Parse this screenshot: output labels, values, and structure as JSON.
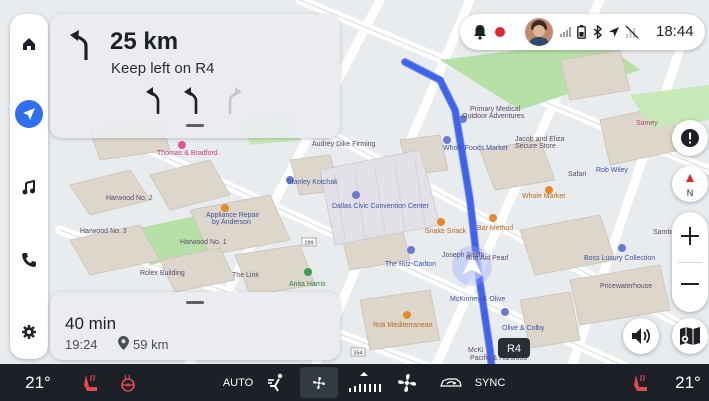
{
  "navigation": {
    "distance": "25 km",
    "instruction": "Keep left on R4",
    "lanes": [
      "keep-left-arrow",
      "keep-left-arrow",
      "keep-left-arrow-inactive"
    ]
  },
  "eta": {
    "duration": "40 min",
    "arrival_time": "19:24",
    "remaining_distance": "59 km"
  },
  "status_bar": {
    "time": "18:44",
    "icons": [
      "bell-icon",
      "recording-dot-icon",
      "avatar",
      "signal-icon",
      "battery-icon",
      "bluetooth-icon",
      "location-icon",
      "no-signal-icon"
    ]
  },
  "sidebar": {
    "items": [
      {
        "name": "home-icon"
      },
      {
        "name": "navigation-icon",
        "active": true
      },
      {
        "name": "music-icon"
      },
      {
        "name": "phone-icon"
      },
      {
        "name": "settings-icon"
      }
    ]
  },
  "map": {
    "road_shield": "R4",
    "road_number_1": "289",
    "road_number_2": "354",
    "compass_label": "N",
    "labels": [
      "Primary Medical",
      "Outdoor Adventures",
      "Whole Foods Market",
      "Jacob and Eliza",
      "Secure Store",
      "Audrey Dike Firming",
      "Thomas & Bradford",
      "Stanley Kotchak",
      "Dallas Civic Convention Center",
      "Harwood No. 2",
      "Appliance Repair",
      "by Anderson",
      "Harwood No. 3",
      "Harwood No. 1",
      "Rolex Building",
      "The Link",
      "Anita Harris",
      "The Ritz-Carlton",
      "Snake Snack",
      "Bar Method",
      "Joseph Smith",
      "Rite Aid Pearl",
      "McKinney & Olive",
      "Roti Mediterranean",
      "Olive & Colby",
      "Boss Luxury Collection",
      "Pricewaterhouse",
      "Whole Market",
      "Rob Wiley",
      "Safari",
      "Sambo",
      "Samey",
      "Pacific & Harwood",
      "McKi"
    ]
  },
  "climate": {
    "left_temp": "21°",
    "right_temp": "21°",
    "auto_label": "AUTO",
    "sync_label": "SYNC"
  },
  "colors": {
    "route": "#3d63f0",
    "accent": "#2f6ff0",
    "record": "#e3242b",
    "climate_bar": "#1c2127",
    "seat_heat": "#e5484d"
  }
}
